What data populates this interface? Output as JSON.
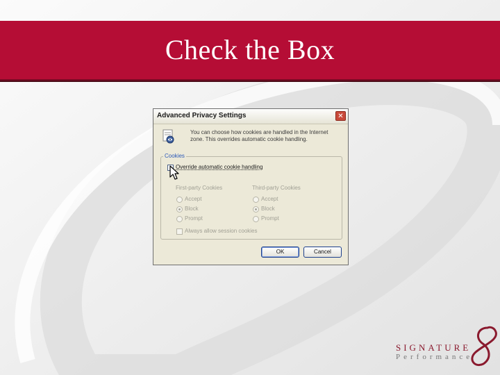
{
  "slide": {
    "title": "Check the Box"
  },
  "dialog": {
    "title": "Advanced Privacy Settings",
    "close_label": "✕",
    "description": "You can choose how cookies are handled in the Internet zone. This overrides automatic cookie handling.",
    "cookies_group_label": "Cookies",
    "override_label": "Override automatic cookie handling",
    "override_checked": false,
    "first_party": {
      "header": "First-party Cookies",
      "options": [
        "Accept",
        "Block",
        "Prompt"
      ],
      "selected": "Block"
    },
    "third_party": {
      "header": "Third-party Cookies",
      "options": [
        "Accept",
        "Block",
        "Prompt"
      ],
      "selected": "Block"
    },
    "session_label": "Always allow session cookies",
    "ok_label": "OK",
    "cancel_label": "Cancel"
  },
  "logo": {
    "line1": "SIGNATURE",
    "line2": "Performance"
  },
  "colors": {
    "banner": "#b50d35",
    "logo": "#8a1a2e"
  }
}
